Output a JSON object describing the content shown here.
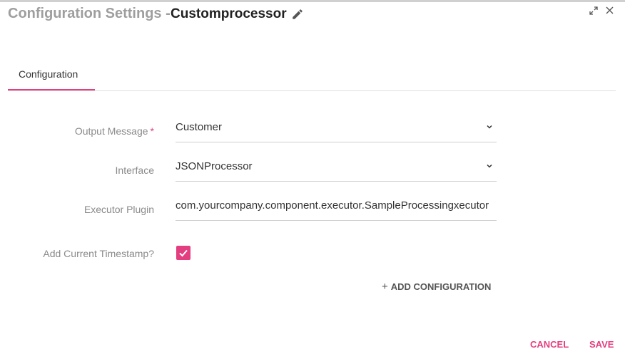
{
  "header": {
    "title": "Configuration Settings -",
    "component_name": "Customprocessor"
  },
  "tabs": [
    {
      "label": "Configuration",
      "active": true
    }
  ],
  "form": {
    "output_message": {
      "label": "Output Message",
      "required_mark": "*",
      "value": "Customer"
    },
    "interface": {
      "label": "Interface",
      "value": "JSONProcessor"
    },
    "executor_plugin": {
      "label": "Executor Plugin",
      "value": "com.yourcompany.component.executor.SampleProcessingxecutor"
    },
    "add_timestamp": {
      "label": "Add Current Timestamp?",
      "checked": true
    }
  },
  "actions": {
    "add_configuration": "ADD CONFIGURATION",
    "add_configuration_icon": "+",
    "cancel": "CANCEL",
    "save": "SAVE"
  },
  "icons": {
    "edit": "pencil-icon",
    "expand": "expand-icon",
    "close": "close-icon",
    "chevron": "chevron-down-icon",
    "check": "check-icon"
  },
  "colors": {
    "accent": "#e33e7f",
    "title_gray": "#9e9e9e",
    "label_gray": "#8a8a8a"
  }
}
